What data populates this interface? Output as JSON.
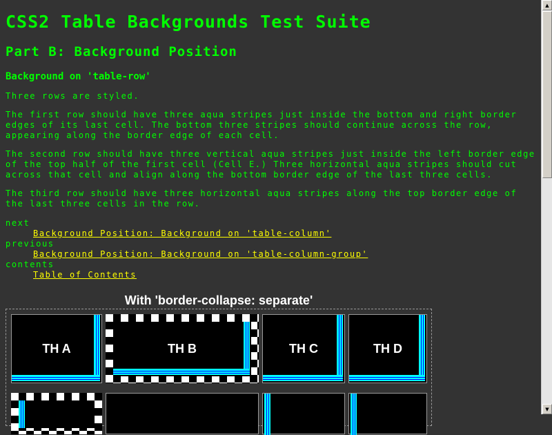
{
  "title": "CSS2 Table Backgrounds Test Suite",
  "part": "Part B: Background Position",
  "section": "Background on 'table-row'",
  "paragraphs": [
    "Three rows are styled.",
    "The first row should have three aqua stripes just inside the bottom and right border edges of its last cell. The bottom three stripes should continue across the row, appearing along the border edge of each cell.",
    "The second row should have three vertical aqua stripes just inside the left border edge of the top half of the first cell (Cell E.) Three horizontal aqua stripes should cut across that cell and align along the bottom border edge of the last three cells.",
    "The third row should have three horizontal aqua stripes along the top border edge of the last three cells in the row."
  ],
  "nav": {
    "next_label": "next",
    "next_link": "Background Position: Background on 'table-column'",
    "previous_label": "previous",
    "previous_link": "Background Position: Background on 'table-column-group'",
    "contents_label": "contents",
    "contents_link": "Table of Contents"
  },
  "table": {
    "caption": "With 'border-collapse: separate'",
    "headers": [
      "TH A",
      "TH B",
      "TH C",
      "TH D"
    ]
  },
  "colors": {
    "background": "#333333",
    "text": "#00ff00",
    "link": "#ffff00",
    "stripe": "#00ffff"
  }
}
